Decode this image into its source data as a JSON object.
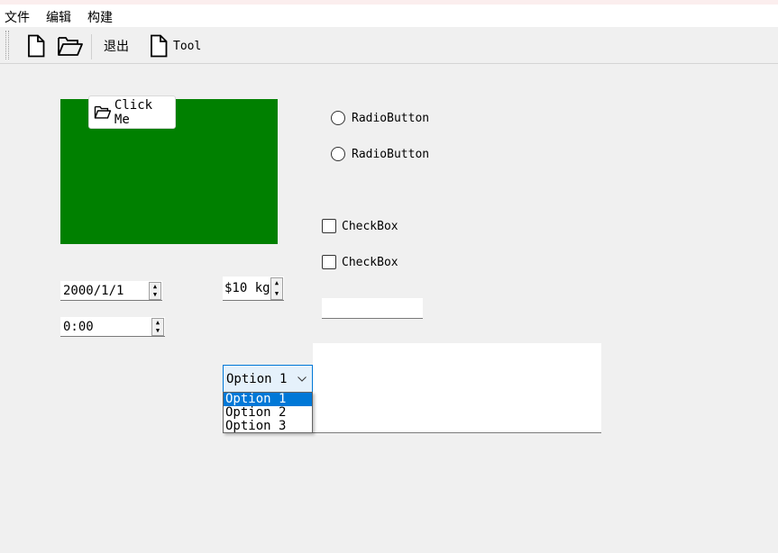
{
  "menubar": {
    "items": [
      "文件",
      "编辑",
      "构建"
    ]
  },
  "toolbar": {
    "exit_label": "退出",
    "tool_label": "Tool"
  },
  "click_button": {
    "label": "Click Me"
  },
  "radios": [
    "RadioButton",
    "RadioButton"
  ],
  "checkboxes": [
    "CheckBox",
    "CheckBox"
  ],
  "date_field": {
    "value": "2000/1/1"
  },
  "time_field": {
    "value": "0:00"
  },
  "numeric_field": {
    "value": "$10 kg"
  },
  "text_input": {
    "value": ""
  },
  "combo": {
    "selected": "Option 1",
    "options": [
      "Option 1",
      "Option 2",
      "Option 3"
    ]
  },
  "colors": {
    "panel": "#008000",
    "accent": "#0078d7"
  }
}
